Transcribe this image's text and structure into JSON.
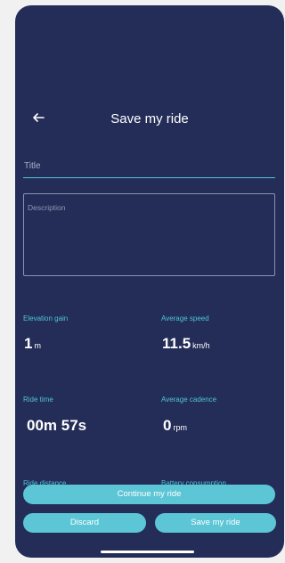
{
  "header": {
    "title": "Save my ride"
  },
  "form": {
    "title_placeholder": "Title",
    "description_placeholder": "Description"
  },
  "stats": {
    "elevation": {
      "label": "Elevation gain",
      "value": "1",
      "unit": "m"
    },
    "avg_speed": {
      "label": "Average speed",
      "value": "11.5",
      "unit": "km/h"
    },
    "ride_time": {
      "label": "Ride time",
      "value": "00m 57s"
    },
    "avg_cadence": {
      "label": "Average cadence",
      "value": "0",
      "unit": "rpm"
    },
    "ride_distance": {
      "label": "Ride distance"
    },
    "battery": {
      "label": "Battery consumption"
    }
  },
  "actions": {
    "continue_label": "Continue my ride",
    "discard_label": "Discard",
    "save_label": "Save my ride"
  },
  "colors": {
    "background": "#242d57",
    "accent": "#4fc3d7",
    "button": "#5cc6d6"
  },
  "icons": {
    "back": "arrow-left-icon"
  }
}
